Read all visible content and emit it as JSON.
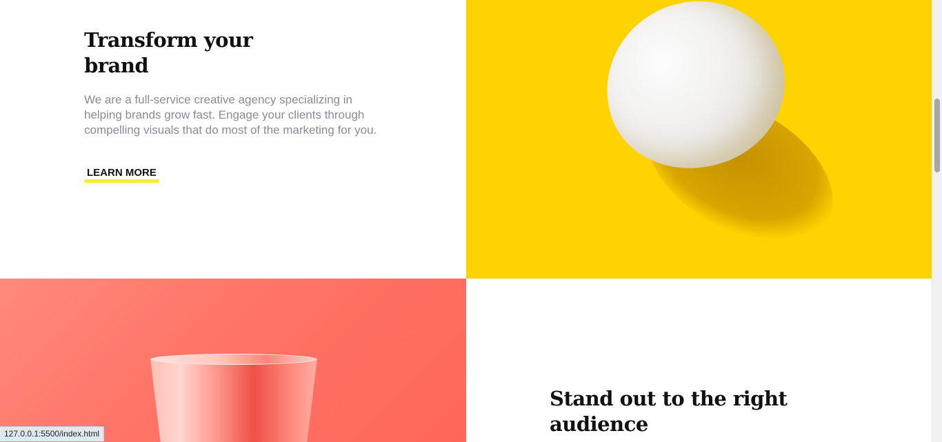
{
  "transform_section": {
    "heading_line1": "Transform your",
    "heading_line2": "brand",
    "description": "We are a full-service creative agency specializing in helping brands grow fast. Engage your clients through compelling visuals that do most of the marketing for you.",
    "cta_label": "LEARN MORE"
  },
  "standout_section": {
    "heading_line1": "Stand out to the right",
    "heading_line2": "audience"
  },
  "status_bar": {
    "url": "127.0.0.1:5500/index.html"
  },
  "colors": {
    "accent_yellow": "#ffd300",
    "underline_yellow": "#fef01f",
    "coral": "#ff7466",
    "heading_text": "#111111",
    "body_text": "#8a8b96"
  }
}
